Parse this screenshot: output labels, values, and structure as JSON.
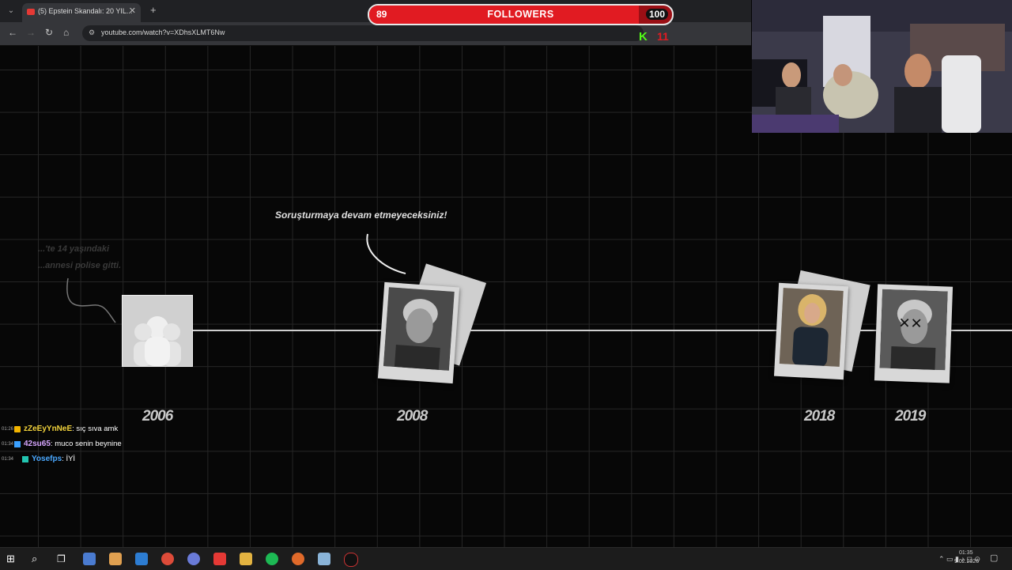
{
  "browser": {
    "tab_title": "(5) Epstein Skandalı: 20 YIL...",
    "url": "youtube.com/watch?v=XDhsXLMT6Nw"
  },
  "video": {
    "quote": "Soruşturmaya devam etmeyeceksiniz!",
    "note_line1": "...'te 14 yaşındaki",
    "note_line2": "...annesi polise gitti.",
    "years": [
      "2006",
      "2008",
      "2018",
      "2019"
    ]
  },
  "followers": {
    "current": "89",
    "label": "FOLLOWERS",
    "goal": "100",
    "progress": 0.89
  },
  "kick": {
    "logo": "K",
    "count": "11"
  },
  "chat": [
    {
      "time": "01:26",
      "user": "zZeEyYnNeE",
      "user_color": "#f2d33c",
      "badge": "crown-icon",
      "message": ": sıç sıva amk"
    },
    {
      "time": "01:34",
      "user": "42su65",
      "user_color": "#d7a6ff",
      "badge": "kick-badge-icon",
      "message": ": muco senin beynine"
    },
    {
      "time": "01:34",
      "user": "Yosefps",
      "user_color": "#4aa8ff",
      "badge": "kick-badge-icon",
      "message": ": İYİ"
    }
  ],
  "taskbar": {
    "clock_time": "01:35",
    "clock_date": "9.02.2026"
  },
  "colors": {
    "accent_red": "#e11b22",
    "kick_green": "#53fc18"
  }
}
